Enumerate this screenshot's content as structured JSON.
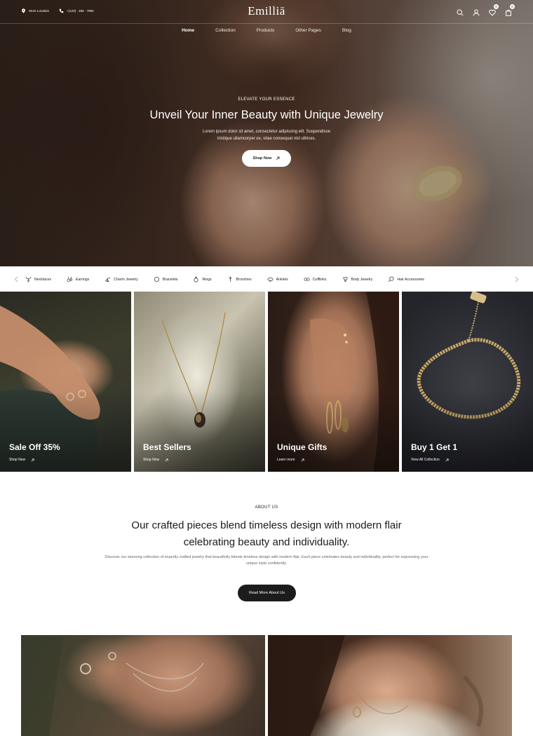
{
  "topbar": {
    "store_location": "Store Location",
    "phone": "+(123) · 456 · 7890",
    "logo": "Emilliā",
    "wishlist_count": "0",
    "cart_count": "0"
  },
  "nav": [
    "Home",
    "Collection",
    "Products",
    "Other Pages",
    "Blog"
  ],
  "hero": {
    "eyebrow": "ELEVATE YOUR ESSENCE",
    "title": "Unveil Your Inner Beauty with Unique Jewelry",
    "description": "Lorem ipsum dolor sit amet, consectetur adipiscing elit. Suspendisse tristique ullamcorper ex, vitae consequat nisl ultrices.",
    "cta": "Shop Now"
  },
  "categories": [
    {
      "label": "Necklaces",
      "icon": "necklace-icon"
    },
    {
      "label": "Earrings",
      "icon": "earring-icon"
    },
    {
      "label": "Charm Jewelry",
      "icon": "charm-icon"
    },
    {
      "label": "Bracelets",
      "icon": "bracelet-icon"
    },
    {
      "label": "Rings",
      "icon": "ring-icon"
    },
    {
      "label": "Brooches",
      "icon": "brooch-icon"
    },
    {
      "label": "Anklets",
      "icon": "anklet-icon"
    },
    {
      "label": "Cufflinks",
      "icon": "cufflink-icon"
    },
    {
      "label": "Body Jewelry",
      "icon": "body-jewelry-icon"
    },
    {
      "label": "Hair Accessories",
      "icon": "hair-accessory-icon"
    }
  ],
  "banners": [
    {
      "title": "Sale Off 35%",
      "link": "Shop Now"
    },
    {
      "title": "Best Sellers",
      "link": "Shop Now"
    },
    {
      "title": "Unique Gifts",
      "link": "Learn more"
    },
    {
      "title": "Buy 1 Get 1",
      "link": "View All Collection"
    }
  ],
  "about": {
    "eyebrow": "ABOUT US",
    "title_line1": "Our crafted pieces blend timeless design with modern flair",
    "title_line2": "celebrating beauty and individuality.",
    "description": "Discover our stunning collection of expertly crafted jewelry that beautifully blends timeless design with modern flair. Each piece celebrates beauty and individuality, perfect for expressing your unique style confidently.",
    "cta": "Read More About Us"
  },
  "colors": {
    "accent_dark": "#1c1c1c",
    "text_muted": "#666666"
  }
}
